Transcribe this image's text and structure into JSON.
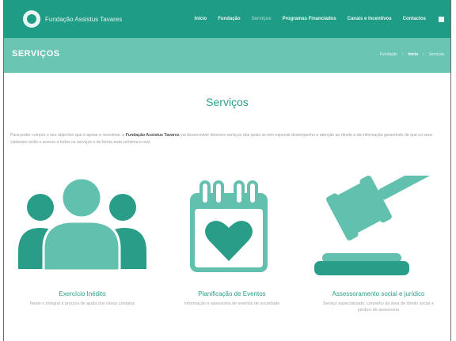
{
  "brand": {
    "name": "Fundação Assistus Tavares"
  },
  "nav": {
    "items": [
      {
        "label": "Início"
      },
      {
        "label": "Fundação"
      },
      {
        "label": "Serviços"
      },
      {
        "label": "Programas Financiados"
      },
      {
        "label": "Canais e Incentivos"
      },
      {
        "label": "Contactos"
      }
    ],
    "active_index": 2
  },
  "page_header": {
    "title": "SERVIÇOS",
    "breadcrumbs": [
      "Fundação",
      "Início",
      "Serviços"
    ]
  },
  "main": {
    "title": "Serviços",
    "intro_before": "Para poder cumprir o seu objectivo que é apoiar e incentivar, a ",
    "intro_bold": "Fundação Assistus Tavares",
    "intro_after": " vai desenvolver diversos serviços dos quais se tem especial desempenho e atenção ao direito a da informação garantindo de que os seus visitantes terão o acesso a todos os serviços e de forma mais próxima e real."
  },
  "services": [
    {
      "icon": "people-group-icon",
      "title": "Exercício Inédito",
      "description": "Neste o Integral à procura de ajuda dos vários contatos"
    },
    {
      "icon": "calendar-heart-icon",
      "title": "Planificação de Eventos",
      "description": "Informação e assessoria de eventos de sociedade"
    },
    {
      "icon": "gavel-icon",
      "title": "Assessoramento social e jurídico",
      "description": "Serviço especializado, conselho da área de direito social e jurídico de assessoria"
    }
  ],
  "colors": {
    "topbar": "#1f9c86",
    "band": "#6ac5b3",
    "accent": "#2a9d88",
    "icon_dark": "#2a9d88",
    "icon_light": "#62c1ae"
  }
}
